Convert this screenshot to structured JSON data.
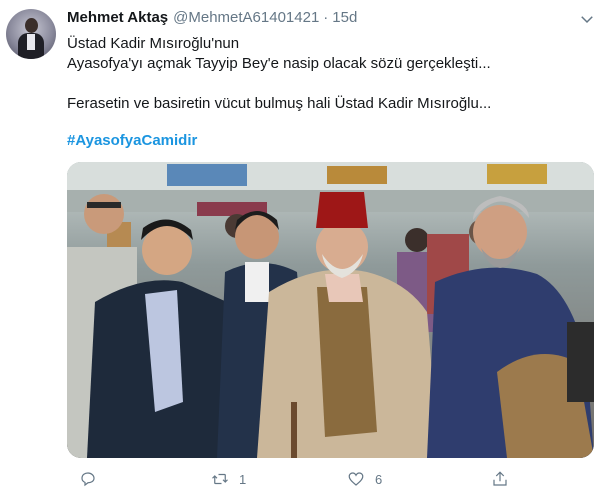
{
  "tweet": {
    "display_name": "Mehmet Aktaş",
    "handle": "@MehmetA61401421",
    "separator": "·",
    "time": "15d",
    "lines": [
      "Üstad Kadir Mısıroğlu'nun",
      "Ayasofya'yı açmak Tayyip Bey'e nasip olacak sözü gerçekleşti...",
      "Ferasetin ve basiretin vücut bulmuş hali Üstad Kadir Mısıroğlu..."
    ],
    "hashtag": "#AyasofyaCamidir",
    "actions": {
      "reply_count": "",
      "retweet_count": "1",
      "like_count": "6"
    }
  },
  "colors": {
    "text": "#14171a",
    "secondary": "#657786",
    "link": "#1b95e0"
  },
  "icons": [
    "chevron-down-icon",
    "reply-icon",
    "retweet-icon",
    "like-icon",
    "share-icon"
  ]
}
